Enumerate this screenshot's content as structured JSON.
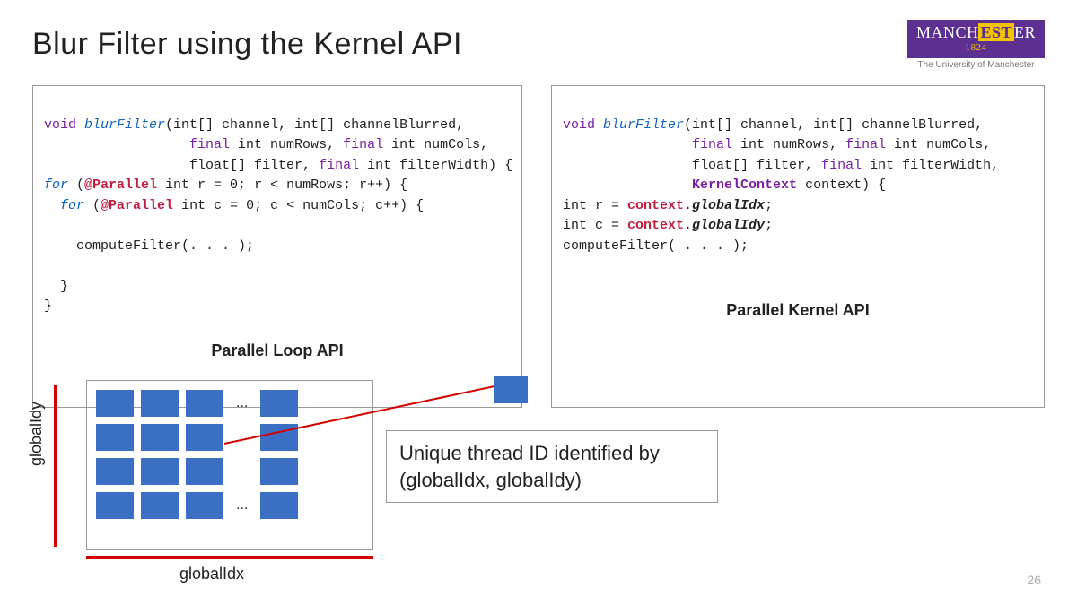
{
  "slide": {
    "title": "Blur Filter using the Kernel API",
    "page_number": "26"
  },
  "logo": {
    "text_pre": "MANCH",
    "text_mid": "EST",
    "text_post": "ER",
    "year": "1824",
    "subtitle": "The University of Manchester"
  },
  "left_code": {
    "api_label": "Parallel Loop API",
    "l1_kw_void": "void",
    "l1_fname": "blurFilter",
    "l1_rest": "(int[] channel, int[] channelBlurred,",
    "l2_kw_final1": "final",
    "l2_mid": " int numRows, ",
    "l2_kw_final2": "final",
    "l2_rest": " int numCols,",
    "l3_pre": "float[] filter, ",
    "l3_kw_final": "final",
    "l3_rest": " int filterWidth) {",
    "l4_for": "for",
    "l4_open": " (",
    "l4_ann": "@Parallel",
    "l4_rest": " int r = 0; r < numRows; r++) {",
    "l5_for": "for",
    "l5_open": " (",
    "l5_ann": "@Parallel",
    "l5_rest": " int c = 0; c < numCols; c++) {",
    "l6": "    computeFilter(. . . );",
    "l7": "  }",
    "l8": "}"
  },
  "right_code": {
    "api_label": "Parallel Kernel API",
    "l1_kw_void": "void",
    "l1_fname": "blurFilter",
    "l1_rest": "(int[] channel, int[] channelBlurred,",
    "l2_kw_final1": "final",
    "l2_mid": " int numRows, ",
    "l2_kw_final2": "final",
    "l2_rest": " int numCols,",
    "l3_pre": "float[] filter, ",
    "l3_kw_final": "final",
    "l3_rest": " int filterWidth,",
    "l4_kc": "KernelContext",
    "l4_rest": " context) {",
    "l5_pre": "int r = ",
    "l5_ctx": "context",
    "l5_dot": ".",
    "l5_prop": "globalIdx",
    "l5_semi": ";",
    "l6_pre": "int c = ",
    "l6_ctx": "context",
    "l6_dot": ".",
    "l6_prop": "globalIdy",
    "l6_semi": ";",
    "l7": "computeFilter( . . . );"
  },
  "diagram": {
    "y_label": "globalIdy",
    "x_label": "globalIdx",
    "ellipsis": "...",
    "callout": "Unique thread ID identified by (globalIdx, globalIdy)"
  }
}
